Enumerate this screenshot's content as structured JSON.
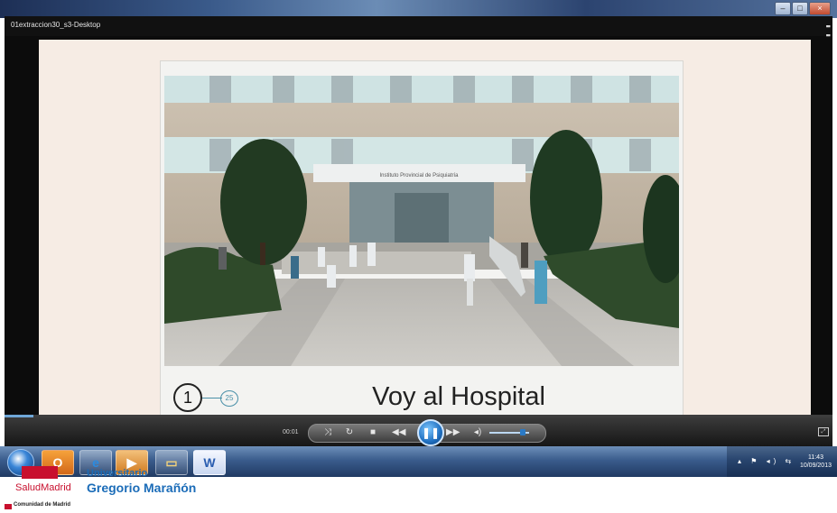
{
  "window": {
    "title": "01extraccion30_s3-Desktop"
  },
  "slide": {
    "current": "1",
    "total": "25",
    "caption": "Voy al Hospital",
    "building_sign": "Instituto Provincial de Psiquiatría"
  },
  "player": {
    "time": "00:01"
  },
  "taskbar": {
    "clock_time": "11:43",
    "clock_date": "10/09/2013",
    "word_label": "W",
    "ie_label": "e"
  },
  "logo": {
    "salud": "SaludMadrid",
    "university": "Universitario",
    "hospital": "Gregorio Marañón",
    "comunidad": "Comunidad de Madrid"
  }
}
